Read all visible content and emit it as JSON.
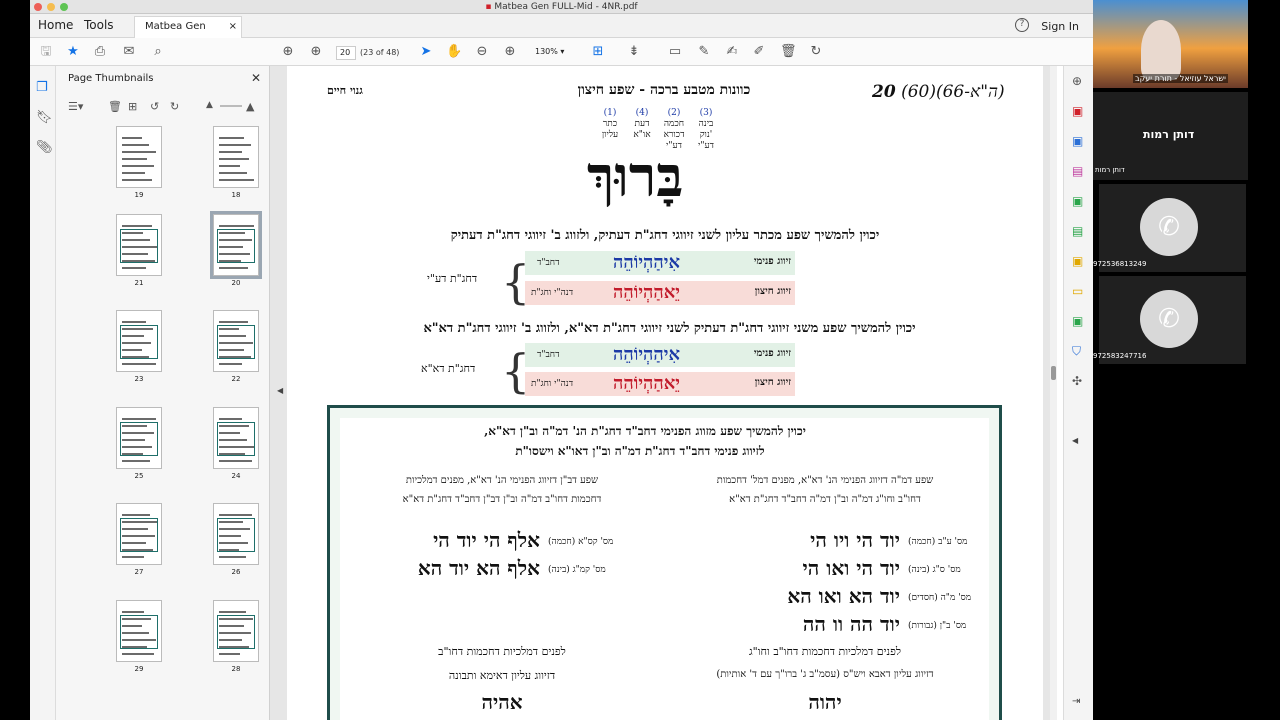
{
  "window": {
    "title": "Matbea Gen FULL-Mid - 4NR.pdf"
  },
  "tabs": {
    "home": "Home",
    "tools": "Tools",
    "doc_tab": "Matbea Gen FULL...",
    "close": "×"
  },
  "header": {
    "help": "?",
    "sign_in": "Sign In"
  },
  "toolbar": {
    "page_number": "20",
    "page_count": "(23 of 48)",
    "zoom": "130%"
  },
  "thumbnails": {
    "title": "Page Thumbnails",
    "close": "✕",
    "items": [
      {
        "label": "19"
      },
      {
        "label": "18"
      },
      {
        "label": "21"
      },
      {
        "label": "20"
      },
      {
        "label": "23"
      },
      {
        "label": "22"
      },
      {
        "label": "25"
      },
      {
        "label": "24"
      },
      {
        "label": "27"
      },
      {
        "label": "26"
      },
      {
        "label": "29"
      },
      {
        "label": "28"
      }
    ]
  },
  "page": {
    "page_num": "20",
    "ref": "(60)(ה\"א-66)",
    "title": "כוונות מטבע ברכה - שפע חיצון",
    "subtitle": "גנוי חיים",
    "cols": [
      {
        "num": "(1)",
        "l1": "כתר",
        "l2": "עליון",
        "l3": ""
      },
      {
        "num": "(4)",
        "l1": "דעת",
        "l2": "או\"א",
        "l3": ""
      },
      {
        "num": "(2)",
        "l1": "חכמה",
        "l2": "דכורא",
        "l3": "דע\"י"
      },
      {
        "num": "(3)",
        "l1": "בינה",
        "l2": "נוק'",
        "l3": "דע\"י"
      }
    ],
    "big_word": "בָּרוּךְ",
    "line1": "יכוין להמשיך שפע מכתר עליון לשני זיווגי דחג\"ת דעתיק, ולזווג ב' זיווגי דחג\"ת דעתיק",
    "block1": {
      "row1_label": "זיווג פנימי",
      "row1_mid": "דחב\"ד",
      "row1_hebrew": "אִיהַהְיוֹהֵה",
      "row2_label": "זיווג חיצון",
      "row2_mid": "דנה\"י וחג\"ת",
      "row2_hebrew": "יֵאהַהְיוֹהֵה",
      "side": "דחג\"ת דע\"י"
    },
    "line2": "יכוין להמשיך שפע משני זיווגי דחג\"ת דעתיק לשני זיווגי דחג\"ת דא\"א, ולזווג ב' זיווגי דחג\"ת דא\"א",
    "block2": {
      "row1_label": "זיווג פנימי",
      "row1_mid": "דחב\"ד",
      "row1_hebrew": "אִיהַהְיוֹהֵה",
      "row2_label": "זיווג חיצון",
      "row2_mid": "דנה\"י וחג\"ת",
      "row2_hebrew": "יֵאהַהְיוֹהֵה",
      "side": "דחג\"ת דא\"א"
    },
    "panel": {
      "intro1": "יכוין להמשיך שפע מזווג הפנימי דחב\"ד דחג\"ת הנ' דמ\"ה וב\"ן דא\"א,",
      "intro2": "לזיווג פנימי דחב\"ד דחג\"ת דמ\"ה וב\"ן דאו\"א וישסו\"ת",
      "right_head1": "שפע דמ\"ה דזיווג הפנימי הנ' דא\"א, מפנים דמל' דחכמות",
      "right_head2": "דחו\"ב וחו\"ג דמ\"ה וב\"ן דמ\"ה דחב\"ד דחג\"ת דא\"א",
      "left_head1": "שפע דב\"ן דזיווג הפנימי הנ' דא\"א, מפנים דמלכיות",
      "left_head2": "דחכמות דחו\"ב דמ\"ה וב\"ן דב\"ן דחב\"ד דחג\"ת דא\"א",
      "right_rows": [
        {
          "label": "מס' ע\"ב (חכמה)",
          "text": "יוד הי ויו הי"
        },
        {
          "label": "מס' ס\"ג (בינה)",
          "text": "יוד הי ואו הי"
        },
        {
          "label": "מס' מ\"ה (חסדים)",
          "text": "יוד הא ואו הא"
        },
        {
          "label": "מס' ב\"ן (גבורות)",
          "text": "יוד הה וו הה"
        }
      ],
      "left_rows": [
        {
          "label": "מס' קס\"א (חכמה)",
          "text": "אלף הי יוד הי"
        },
        {
          "label": "מס' קמ\"ג (בינה)",
          "text": "אלף הא יוד הא"
        }
      ],
      "right_foot1": "לפנים דמלכיות דחכמות דחו\"ב וחו\"ג",
      "right_foot2": "דזיווג עליון דאבא ויש\"ס (עסמ\"ב ג' ברו\"ך עם ד' אותיות)",
      "right_foot3": "יהוה",
      "left_foot1": "לפנים דמלכיות דחכמות דחו\"ב",
      "left_foot2": "דזיווג עליון דאימא ותבונה",
      "left_foot3": "אהיה"
    }
  },
  "video": {
    "speaker_name": "ישראל עוזיאל - תורת יעקב",
    "tile_name": "דותן רמות",
    "small_name": "דותן רמות",
    "phone1": "972536813249",
    "phone2": "972583247716",
    "call_icon": "✆"
  },
  "colors": {
    "accent_blue": "#1473e6",
    "red": "#d0202a",
    "dark_red": "#c21c2c",
    "blue": "#1c3aa6",
    "green_row": "#e2f1e6",
    "pink_row": "#f8dcd8",
    "teal_border": "#1f4d4a"
  }
}
